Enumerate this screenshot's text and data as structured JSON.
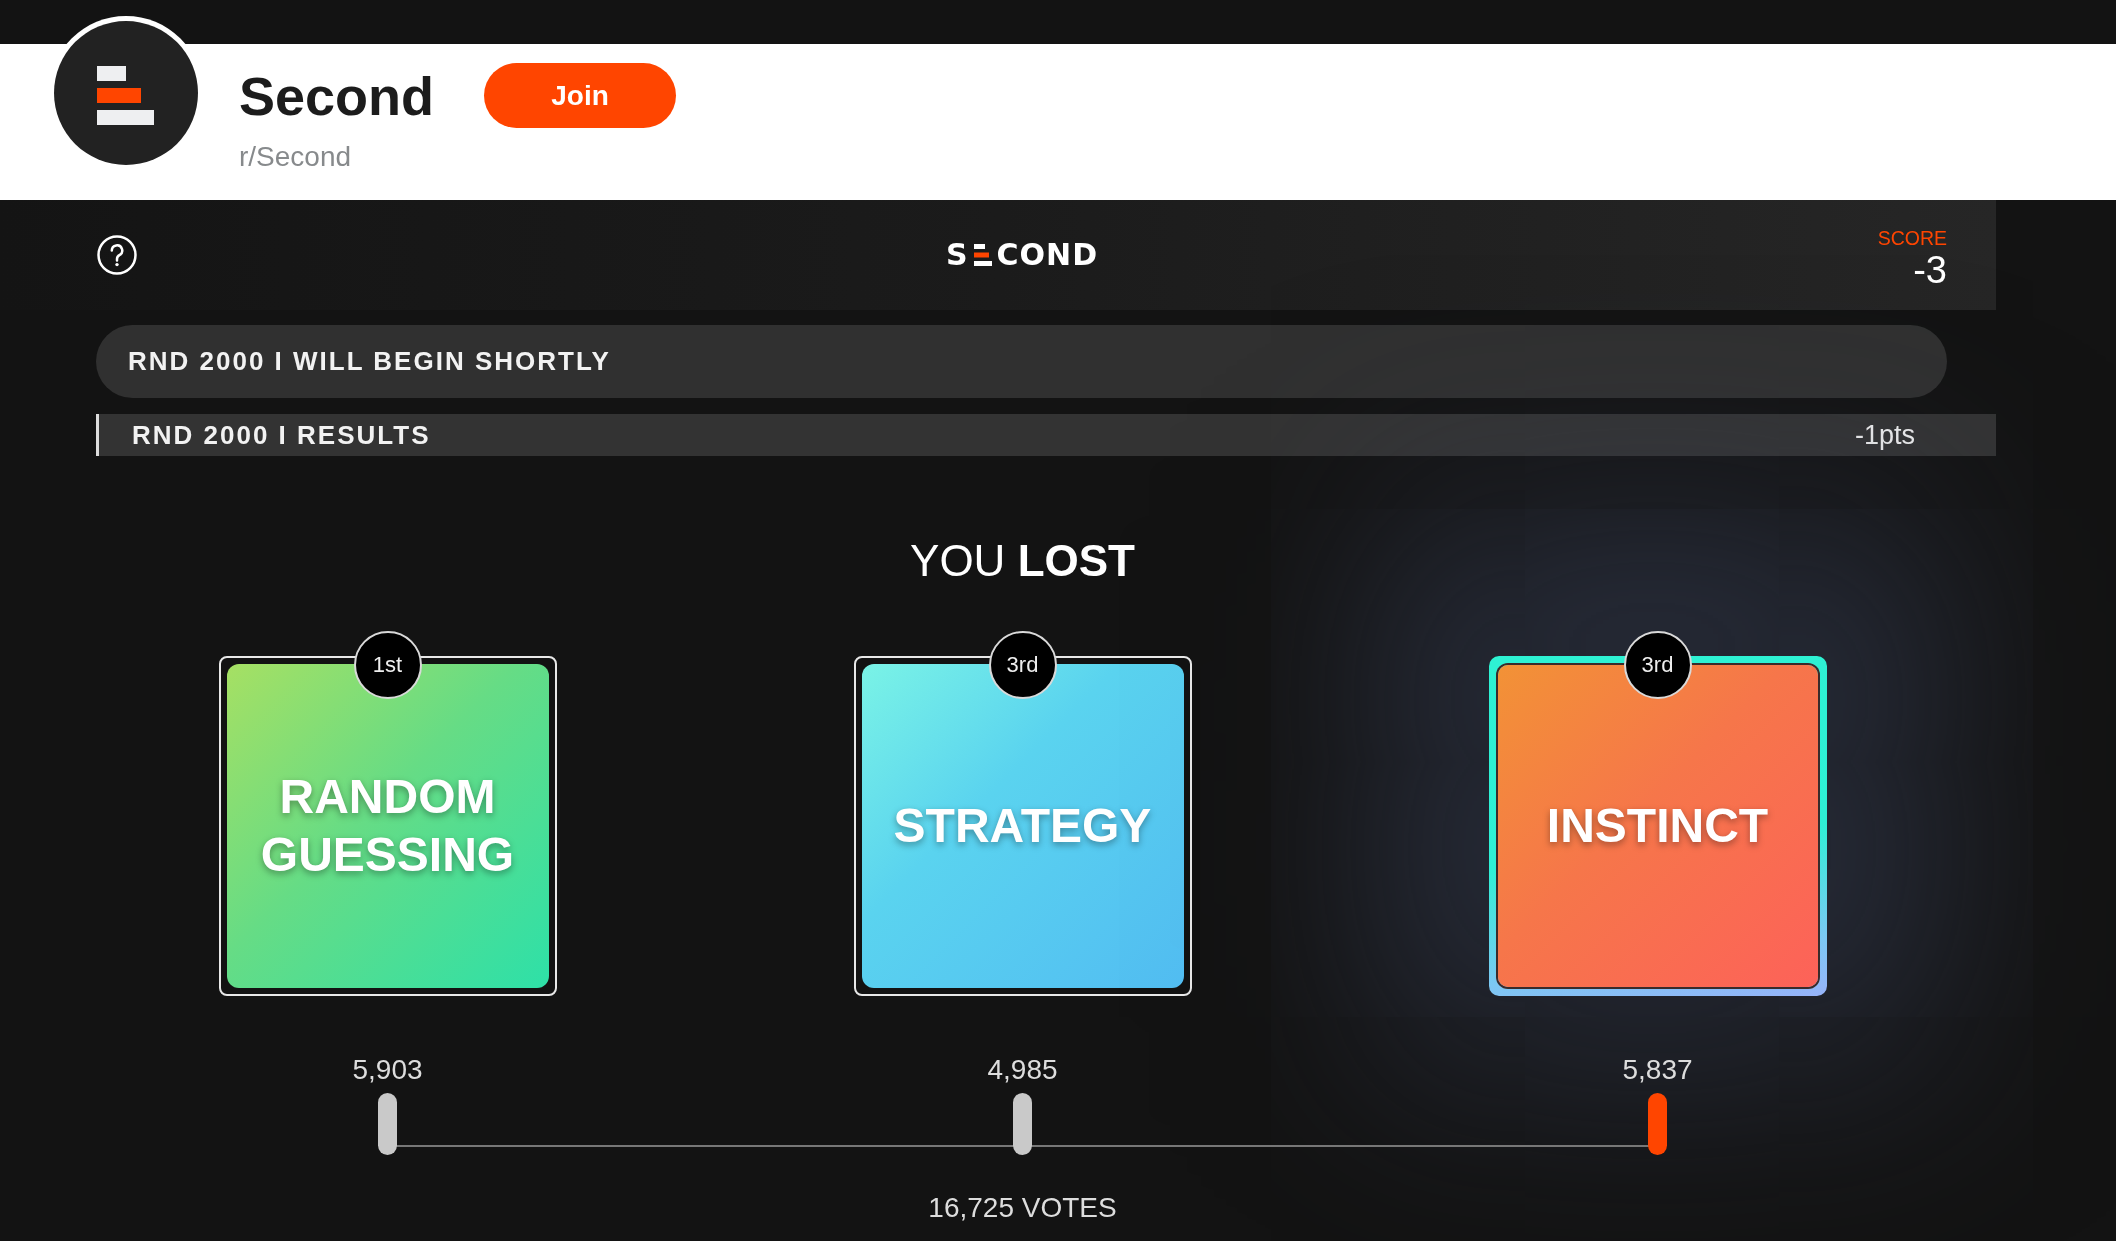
{
  "community": {
    "name": "Second",
    "handle": "r/Second",
    "join_label": "Join"
  },
  "game": {
    "logo": {
      "left": "S",
      "right": "COND"
    },
    "score": {
      "label": "SCORE",
      "value": "-3"
    },
    "status_banner": "RND 2000 I WILL BEGIN SHORTLY",
    "results": {
      "title": "RND 2000 I RESULTS",
      "points": "-1pts",
      "heading": "YOU **LOST**",
      "options": [
        {
          "label": "RANDOM GUESSING",
          "rank": "1st",
          "votes": "5,903",
          "selected": false
        },
        {
          "label": "STRATEGY",
          "rank": "3rd",
          "votes": "4,985",
          "selected": false
        },
        {
          "label": "INSTINCT",
          "rank": "3rd",
          "votes": "5,837",
          "selected": true
        }
      ],
      "total_votes": "16,725 VOTES"
    }
  }
}
